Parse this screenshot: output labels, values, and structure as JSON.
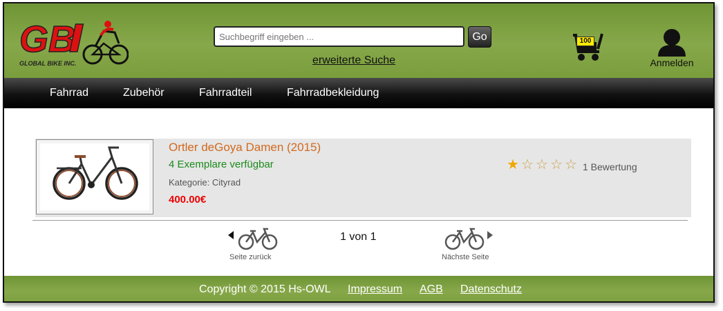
{
  "header": {
    "logo_text": "GB",
    "logo_subtext": "GLOBAL BIKE INC.",
    "search": {
      "placeholder": "Suchbegriff eingeben ...",
      "value": ""
    },
    "go_label": "Go",
    "advanced_search_label": "erweiterte Suche",
    "cart_count": "100",
    "login_label": "Anmelden",
    "accent_color": "#87a84a"
  },
  "nav": {
    "items": [
      {
        "label": "Fahrrad"
      },
      {
        "label": "Zubehör"
      },
      {
        "label": "Fahrradteil"
      },
      {
        "label": "Fahrradbekleidung"
      }
    ]
  },
  "product": {
    "title": "Ortler deGoya Damen (2015)",
    "availability": "4 Exemplare verfügbar",
    "category": "Kategorie: Cityrad",
    "price": "400.00€",
    "rating": 1,
    "rating_max": 5,
    "rating_text": "1 Bewertung"
  },
  "pagination": {
    "prev_label": "Seite zurück",
    "page_text": "1 von 1",
    "next_label": "Nächste Seite"
  },
  "footer": {
    "copyright": "Copyright © 2015 Hs-OWL",
    "links": [
      {
        "label": "Impressum"
      },
      {
        "label": "AGB"
      },
      {
        "label": "Datenschutz"
      }
    ]
  }
}
